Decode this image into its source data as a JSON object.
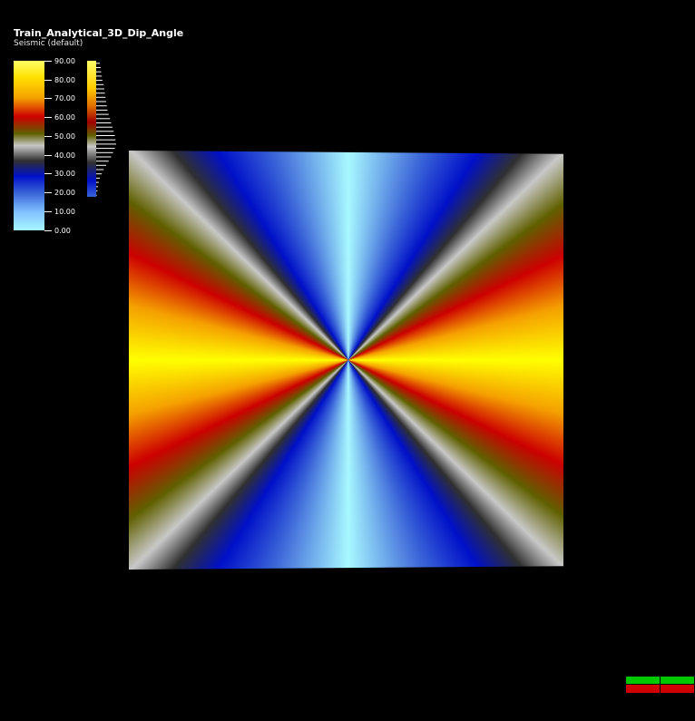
{
  "viewer": {
    "title": "Train_Analytical_3D_Dip_Angle",
    "colormap_name": "Seismic (default)"
  },
  "colorbar": {
    "ticks": [
      "90.00",
      "80.00",
      "70.00",
      "60.00",
      "50.00",
      "40.00",
      "30.00",
      "20.00",
      "10.00",
      "0.00"
    ],
    "max": 90,
    "min": 0,
    "colors": [
      "#ffff66",
      "#ffe000",
      "#f5a000",
      "#cc0000",
      "#606000",
      "#c8c8c8",
      "#303030",
      "#0010c8",
      "#3a64d8",
      "#a8f8ff"
    ]
  },
  "histogram": {
    "values": [
      6,
      7,
      8,
      9,
      10,
      12,
      13,
      14,
      15,
      16,
      17,
      18,
      20,
      22,
      24,
      26,
      28,
      30,
      31,
      32,
      30,
      27,
      24,
      20,
      16,
      12,
      9,
      6,
      4,
      3,
      2,
      1
    ]
  },
  "section": {
    "attribute": "dip angle",
    "icon": "seismic-section-slice"
  },
  "axis_widget": {
    "icon": "orientation-axis-icon",
    "colors": [
      "#00c800",
      "#d00000"
    ]
  }
}
